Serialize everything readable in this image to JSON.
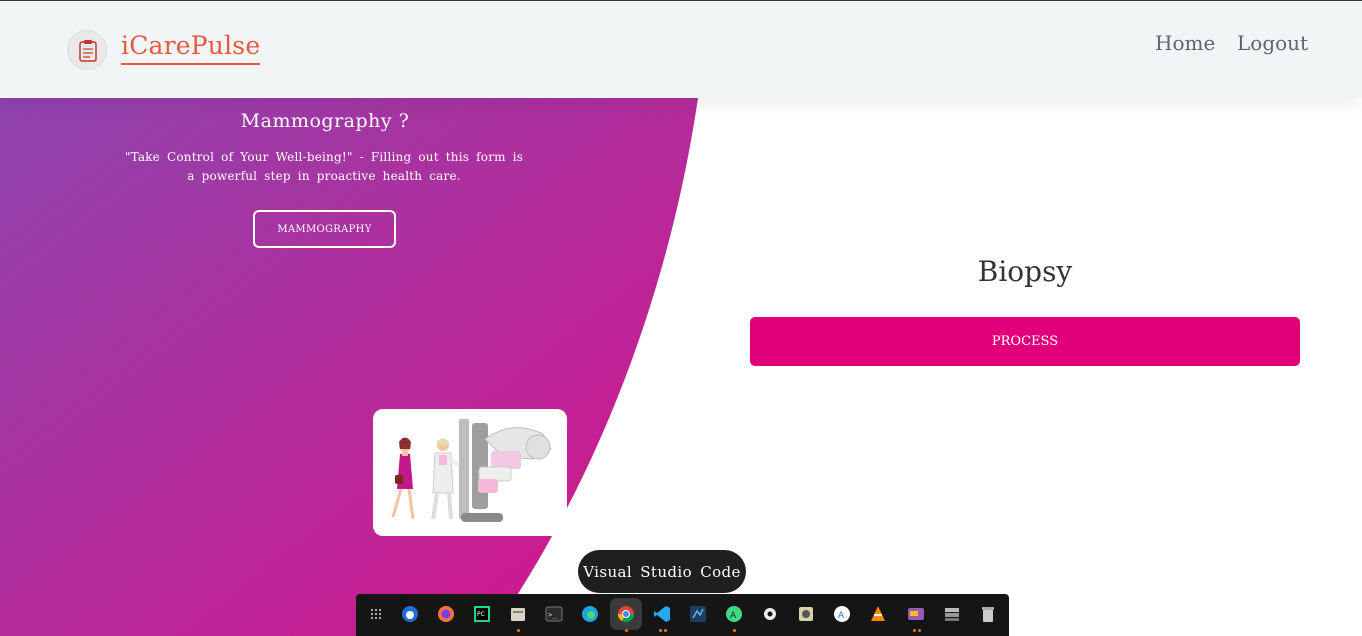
{
  "navbar": {
    "brand": "iCarePulse",
    "links": {
      "home": "Home",
      "logout": "Logout"
    }
  },
  "hero": {
    "title": "Mammography ?",
    "description": "\"Take Control of Your Well-being!\" - Filling out this form is a powerful step in proactive health care.",
    "button_label": "MAMMOGRAPHY"
  },
  "biopsy": {
    "title": "Biopsy",
    "button_label": "PROCESS"
  },
  "tooltip": "Visual Studio Code",
  "taskbar": {
    "icons": [
      "app-grid-icon",
      "thunderbird-icon",
      "firefox-icon",
      "pycharm-icon",
      "file-manager-icon",
      "terminal-icon",
      "edge-icon",
      "chrome-icon",
      "vscode-icon",
      "mysql-workbench-icon",
      "android-studio-icon",
      "settings-icon",
      "disk-icon",
      "software-center-icon",
      "vlc-icon",
      "screenshot-app-icon",
      "storage-icon",
      "trash-icon"
    ]
  },
  "colors": {
    "brand": "#e8583f",
    "gradient_start": "#8e44ad",
    "gradient_end": "#d8138a",
    "process_button": "#e0007a"
  }
}
